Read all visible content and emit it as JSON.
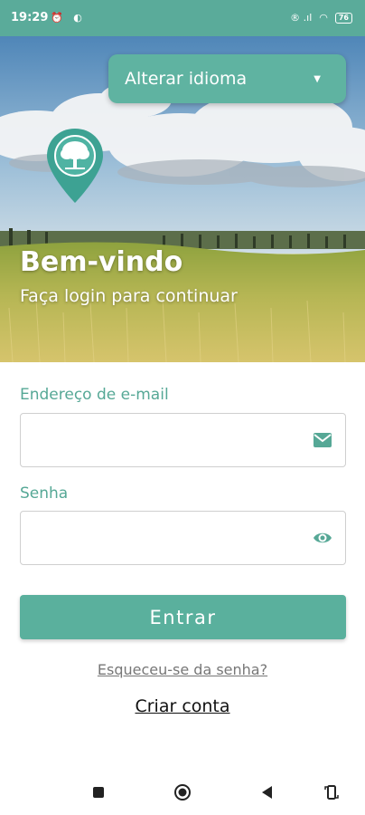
{
  "status_bar": {
    "time": "19:29",
    "battery": "76"
  },
  "header": {
    "language_select": "Alterar idioma",
    "welcome_title": "Bem-vindo",
    "welcome_subtitle": "Faça login para continuar"
  },
  "form": {
    "email_label": "Endereço de e-mail",
    "email_value": "",
    "password_label": "Senha",
    "password_value": "",
    "login_button": "Entrar",
    "forgot_password": "Esqueceu-se da senha?",
    "create_account": "Criar conta"
  },
  "colors": {
    "accent": "#5ab09d",
    "label": "#56a896"
  },
  "icons": {
    "email_field": "mail-icon",
    "password_field": "eye-icon",
    "logo": "map-pin-tree-icon",
    "nav": [
      "square-icon",
      "circle-icon",
      "back-triangle-icon",
      "rotate-icon"
    ]
  }
}
